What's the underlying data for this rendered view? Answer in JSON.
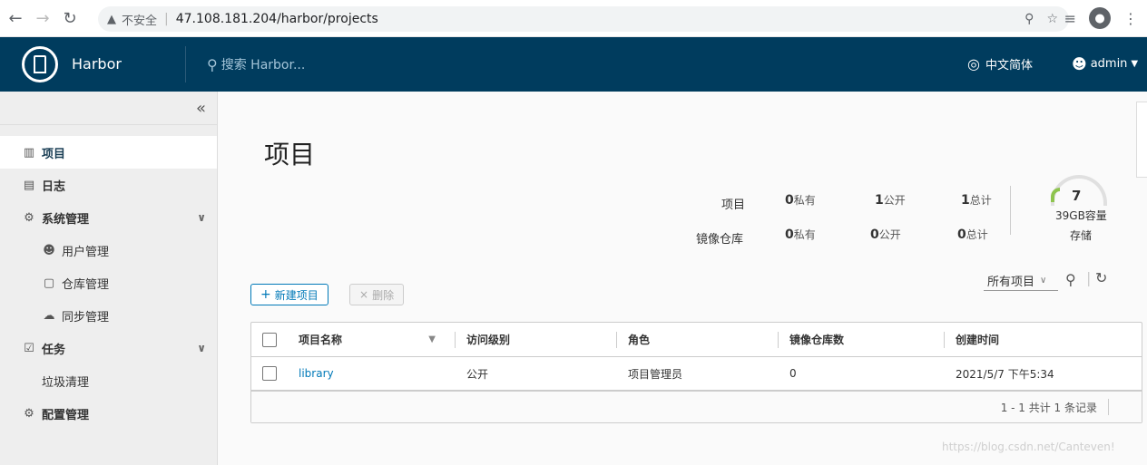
{
  "browser": {
    "insecure_label": "不安全",
    "url": "47.108.181.204/harbor/projects",
    "icons": [
      "back-icon",
      "forward-icon",
      "reload-icon",
      "warning-icon",
      "key-icon",
      "star-icon",
      "playlist-icon",
      "profile-icon",
      "menu-icon"
    ]
  },
  "header": {
    "brand": "Harbor",
    "search_placeholder": "搜索 Harbor...",
    "language": "中文简体",
    "user": "admin"
  },
  "sidebar": {
    "items": [
      {
        "label": "项目",
        "icon": "projects-icon",
        "active": true
      },
      {
        "label": "日志",
        "icon": "log-icon"
      },
      {
        "label": "系统管理",
        "icon": "admin-icon",
        "expandable": true
      },
      {
        "label": "用户管理",
        "icon": "users-icon",
        "sub": true
      },
      {
        "label": "仓库管理",
        "icon": "registry-icon",
        "sub": true
      },
      {
        "label": "同步管理",
        "icon": "replication-icon",
        "sub": true
      },
      {
        "label": "任务",
        "icon": "tasks-icon",
        "expandable": true
      },
      {
        "label": "垃圾清理",
        "sub": true
      },
      {
        "label": "配置管理",
        "icon": "settings-icon"
      }
    ]
  },
  "main": {
    "title": "项目",
    "stats": {
      "project_label": "项目",
      "repo_label": "镜像仓库",
      "project_private": "0",
      "project_public": "1",
      "project_total": "1",
      "repo_private": "0",
      "repo_public": "0",
      "repo_total": "0",
      "private_suffix": "私有",
      "public_suffix": "公开",
      "total_suffix": "总计"
    },
    "storage": {
      "value": "7",
      "capacity": "39GB容量",
      "label": "存储"
    },
    "new_project_label": "新建项目",
    "delete_label": "删除",
    "filter_label": "所有项目",
    "table": {
      "columns": [
        "项目名称",
        "访问级别",
        "角色",
        "镜像仓库数",
        "创建时间"
      ],
      "rows": [
        {
          "name": "library",
          "access": "公开",
          "role": "项目管理员",
          "repo_count": "0",
          "created": "2021/5/7 下午5:34"
        }
      ],
      "footer": "1 - 1 共计 1 条记录"
    }
  },
  "watermark": "https://blog.csdn.net/Canteven!"
}
